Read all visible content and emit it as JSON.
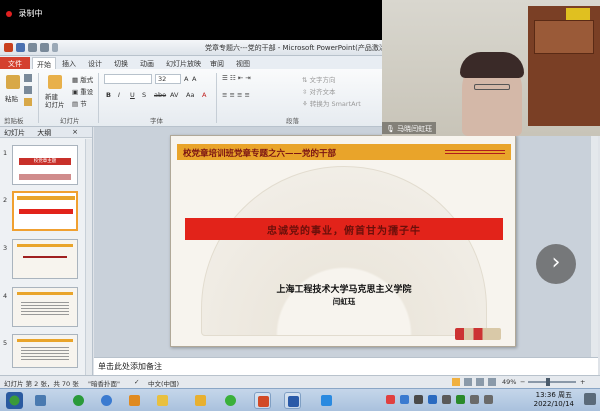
{
  "recording": {
    "label": "录制中"
  },
  "window": {
    "title": "党章专题六---党的干部 - Microsoft PowerPoint(产品激活...)"
  },
  "ribbon_tabs": [
    "文件",
    "开始",
    "插入",
    "设计",
    "切换",
    "动画",
    "幻灯片放映",
    "审阅",
    "视图"
  ],
  "ribbon": {
    "paste": "粘贴",
    "clipboard_group": "剪贴板",
    "new_slide": "新建\n幻灯片",
    "layout": "版式",
    "reset": "重设",
    "section": "节",
    "slides_group": "幻灯片",
    "font_size": "32",
    "font_group": "字体",
    "text_direction": "文字方向",
    "align_text": "对齐文本",
    "smartart": "转换为 SmartArt",
    "paragraph_group": "段落",
    "font_buttons": [
      "B",
      "I",
      "U",
      "S",
      "abe",
      "AV",
      "Aa",
      "A"
    ]
  },
  "panel": {
    "tab_slides": "幻灯片",
    "tab_outline": "大纲",
    "close": "×"
  },
  "thumbnails": [
    {
      "num": "1",
      "caption": "校党章主题"
    },
    {
      "num": "2",
      "caption": ""
    },
    {
      "num": "3",
      "caption": ""
    },
    {
      "num": "4",
      "caption": ""
    },
    {
      "num": "5",
      "caption": ""
    }
  ],
  "slide": {
    "header": "校党章培训班党章专题之六——党的干部",
    "banner": "忠诚党的事业，俯首甘为孺子牛",
    "university": "上海工程技术大学马克思主义学院",
    "author": "闫虹珏"
  },
  "notes_placeholder": "单击此处添加备注",
  "status": {
    "slide_info": "幻灯片 第 2 张，共 70 张",
    "theme": "\"暗香扑面\"",
    "language": "中文(中国)",
    "zoom": "49%"
  },
  "camera": {
    "name": "马晓闫虹珏"
  },
  "taskbar": {
    "time": "13:36 周五",
    "date": "2022/10/14"
  },
  "colors": {
    "accent": "#d4402e",
    "slide_header": "#e9a42a",
    "slide_band": "#e2231a"
  }
}
